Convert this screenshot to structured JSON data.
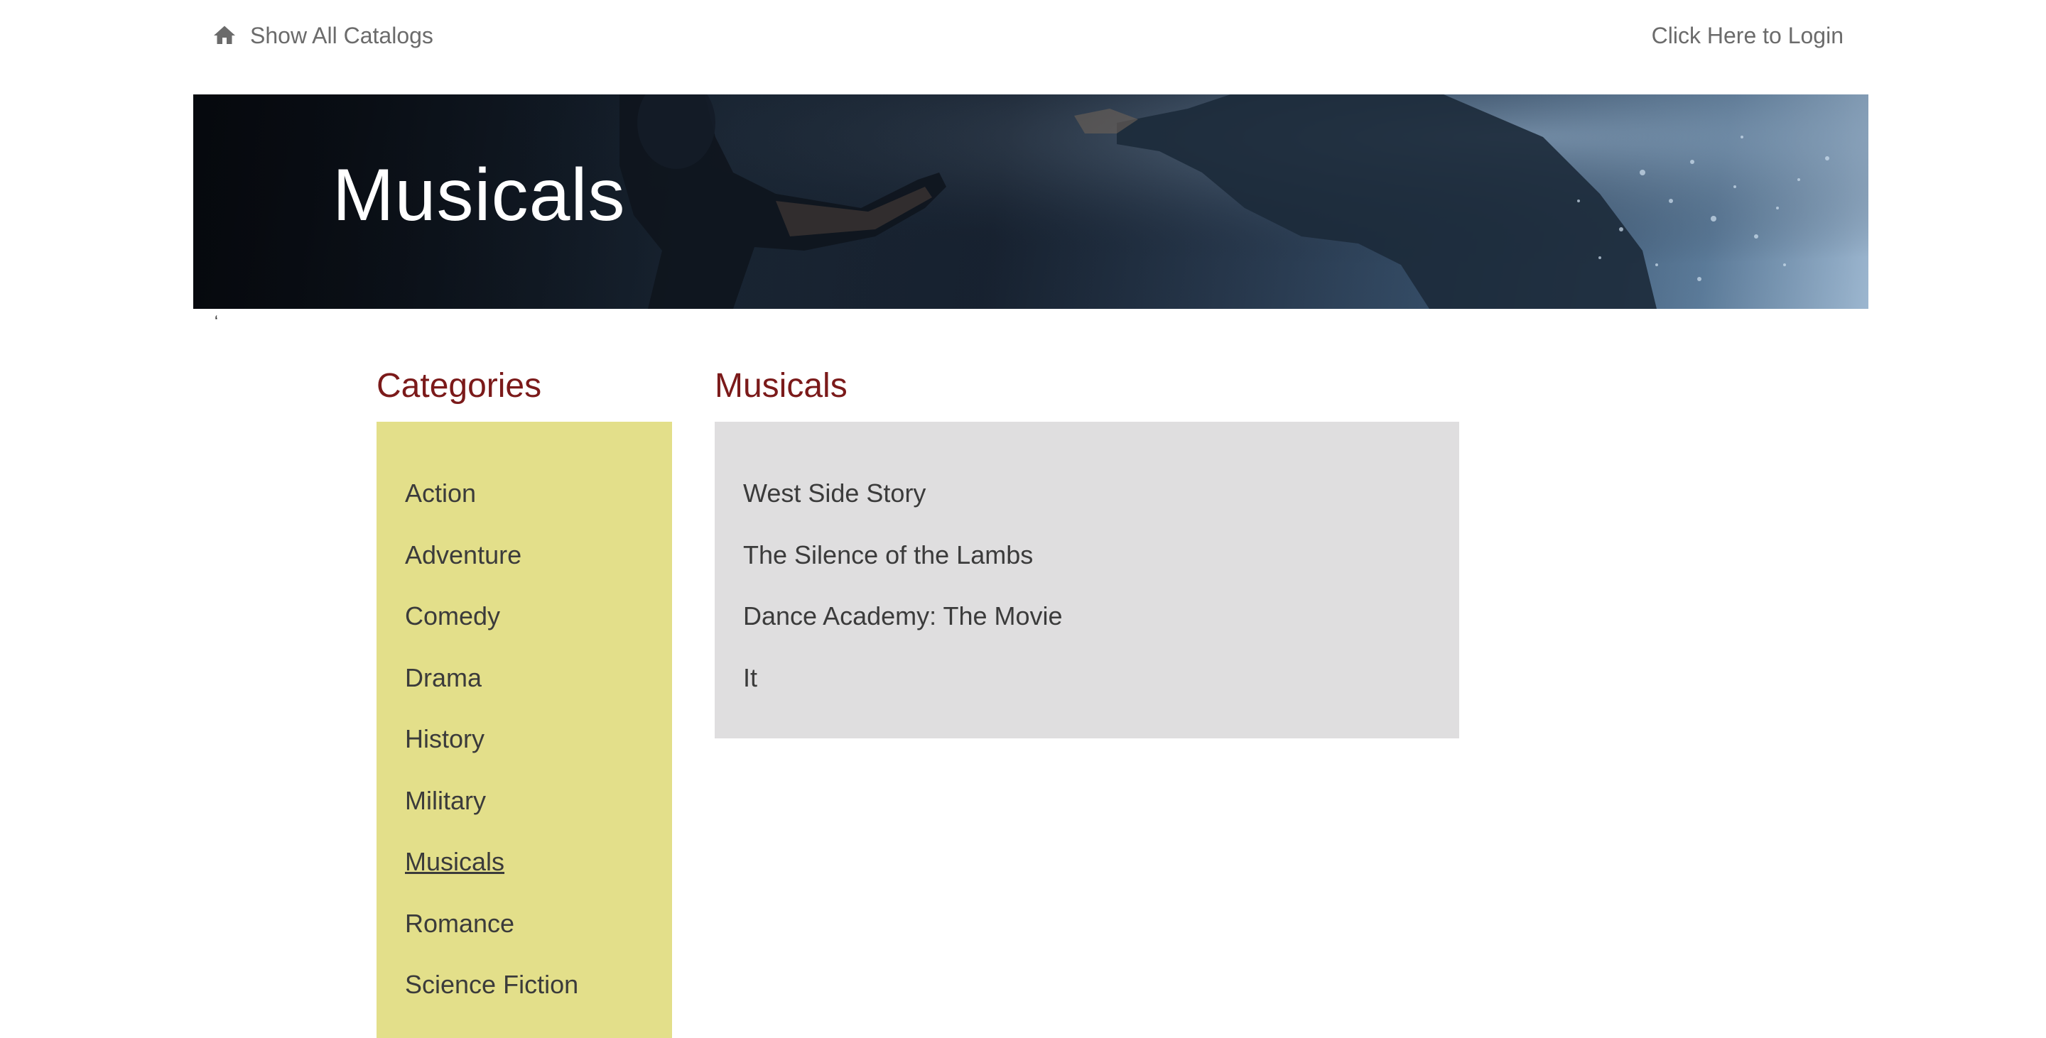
{
  "nav": {
    "home_label": "Show All Catalogs",
    "home_icon": "home-icon",
    "login_label": "Click Here to Login"
  },
  "banner": {
    "title": "Musicals"
  },
  "tick_mark": "‘",
  "sidebar": {
    "heading": "Categories",
    "items": [
      {
        "label": "Action"
      },
      {
        "label": "Adventure"
      },
      {
        "label": "Comedy"
      },
      {
        "label": "Drama"
      },
      {
        "label": "History"
      },
      {
        "label": "Military"
      },
      {
        "label": "Musicals",
        "active": true
      },
      {
        "label": "Romance"
      },
      {
        "label": "Science Fiction"
      }
    ]
  },
  "main": {
    "heading": "Musicals",
    "movies": [
      {
        "title": "West Side Story"
      },
      {
        "title": "The Silence of the Lambs"
      },
      {
        "title": "Dance Academy: The Movie"
      },
      {
        "title": "It"
      }
    ]
  },
  "colors": {
    "heading": "#7b1a1a",
    "sidebar_bg": "#e3df8a",
    "main_bg": "#dfdedf",
    "link_text": "#6b6b6b",
    "body_text": "#3b3b3b"
  }
}
